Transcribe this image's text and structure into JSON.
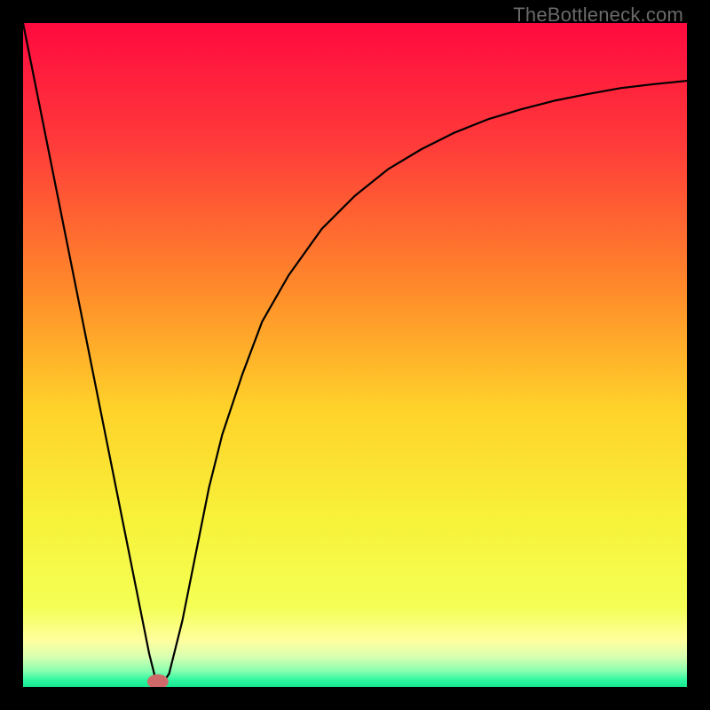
{
  "watermark": "TheBottleneck.com",
  "chart_data": {
    "type": "line",
    "title": "",
    "xlabel": "",
    "ylabel": "",
    "xlim": [
      0,
      100
    ],
    "ylim": [
      0,
      100
    ],
    "grid": false,
    "legend": false,
    "background_gradient": {
      "direction": "vertical",
      "stops": [
        {
          "pos": 0.0,
          "color": "#ff0a3f"
        },
        {
          "pos": 0.18,
          "color": "#ff3a3a"
        },
        {
          "pos": 0.4,
          "color": "#ff8a2a"
        },
        {
          "pos": 0.58,
          "color": "#ffd22a"
        },
        {
          "pos": 0.75,
          "color": "#f7f23a"
        },
        {
          "pos": 0.88,
          "color": "#f4ff55"
        },
        {
          "pos": 0.93,
          "color": "#ffff9e"
        },
        {
          "pos": 0.955,
          "color": "#d7ffb0"
        },
        {
          "pos": 0.975,
          "color": "#8cffb0"
        },
        {
          "pos": 0.99,
          "color": "#2df7a0"
        },
        {
          "pos": 1.0,
          "color": "#17e88f"
        }
      ]
    },
    "series": [
      {
        "name": "bottleneck-curve",
        "color": "#000000",
        "width": 2.2,
        "x": [
          0,
          2,
          4,
          6,
          8,
          10,
          12,
          14,
          16,
          18,
          19,
          20,
          21,
          22,
          24,
          26,
          28,
          30,
          33,
          36,
          40,
          45,
          50,
          55,
          60,
          65,
          70,
          75,
          80,
          85,
          90,
          95,
          100
        ],
        "y": [
          100,
          90,
          80,
          70,
          60,
          50,
          40,
          30,
          20,
          10,
          5,
          1,
          0.5,
          2,
          10,
          20,
          30,
          38,
          47,
          55,
          62,
          69,
          74,
          78,
          81,
          83.5,
          85.5,
          87,
          88.3,
          89.3,
          90.2,
          90.8,
          91.3
        ]
      }
    ],
    "marker": {
      "x": 20.3,
      "y": 0.8,
      "rx": 1.6,
      "ry": 1.1,
      "color": "#d06a6a"
    }
  }
}
